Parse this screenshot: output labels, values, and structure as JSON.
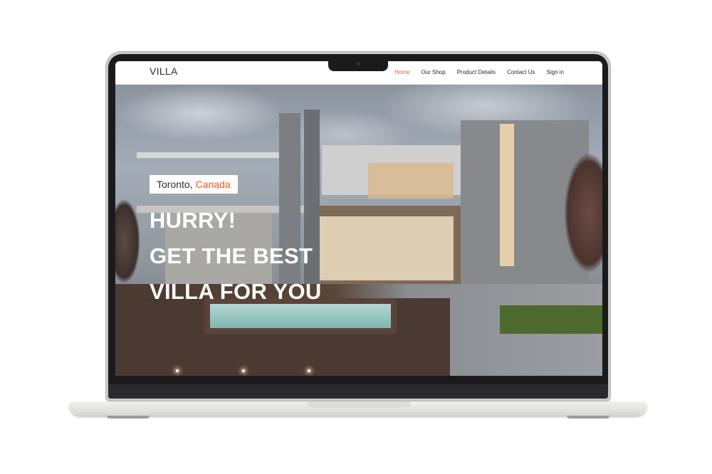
{
  "site": {
    "logo": "VILLA"
  },
  "nav": {
    "items": [
      {
        "label": "Home",
        "active": true
      },
      {
        "label": "Our Shop",
        "active": false
      },
      {
        "label": "Product Details",
        "active": false
      },
      {
        "label": "Contact Us",
        "active": false
      },
      {
        "label": "Sign in",
        "active": false
      }
    ]
  },
  "hero": {
    "location_city": "Toronto,",
    "location_country": "Canada",
    "headline_line1": "HURRY!",
    "headline_line2": "GET THE BEST",
    "headline_line3": "VILLA FOR YOU"
  },
  "colors": {
    "accent": "#f35525",
    "text": "#2b2b2b",
    "nav_bg": "#ffffff"
  }
}
